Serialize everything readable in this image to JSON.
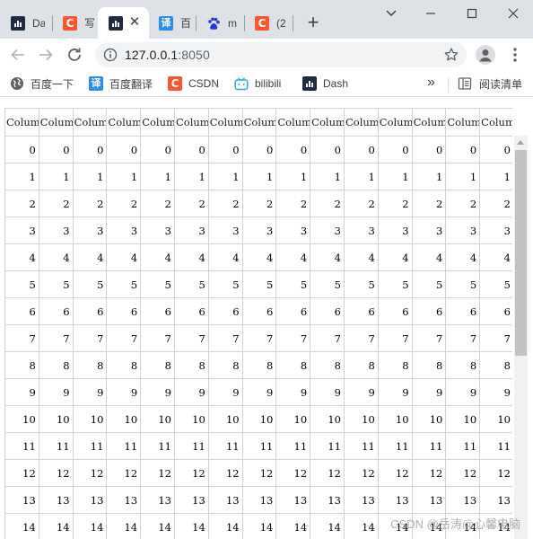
{
  "tabs": [
    {
      "icon": "dash-icon",
      "title": "Da"
    },
    {
      "icon": "csdn-icon",
      "title": "写"
    },
    {
      "icon": "dash-icon",
      "title": "",
      "active": true
    },
    {
      "icon": "translate-icon",
      "title": "百"
    },
    {
      "icon": "baidu-paw-icon",
      "title": "m"
    },
    {
      "icon": "csdn-icon",
      "title": "(2"
    }
  ],
  "address_bar": {
    "host": "127.0.0.1",
    "port": ":8050"
  },
  "bookmarks": [
    {
      "label": "百度一下",
      "icon": "globe-icon"
    },
    {
      "label": "百度翻译",
      "icon": "translate-icon"
    },
    {
      "label": "CSDN",
      "icon": "csdn-icon"
    },
    {
      "label": "bilibili",
      "icon": "bilibili-icon"
    },
    {
      "label": "Dash",
      "icon": "dash-icon"
    }
  ],
  "bookmarks_more": "»",
  "reading_list": {
    "label": "阅读清单",
    "icon": "reading-list-icon"
  },
  "csdn_glyph": "C",
  "translate_glyph": "译",
  "table": {
    "headers": [
      "Colum",
      "Colum",
      "Colum",
      "Colum",
      "Colum",
      "Colum",
      "Colum",
      "Colum",
      "Colum",
      "Colum",
      "Colum",
      "Colum",
      "Colum",
      "Colum",
      "Colum"
    ],
    "rows": [
      [
        "0",
        "0",
        "0",
        "0",
        "0",
        "0",
        "0",
        "0",
        "0",
        "0",
        "0",
        "0",
        "0",
        "0",
        "0"
      ],
      [
        "1",
        "1",
        "1",
        "1",
        "1",
        "1",
        "1",
        "1",
        "1",
        "1",
        "1",
        "1",
        "1",
        "1",
        "1"
      ],
      [
        "2",
        "2",
        "2",
        "2",
        "2",
        "2",
        "2",
        "2",
        "2",
        "2",
        "2",
        "2",
        "2",
        "2",
        "2"
      ],
      [
        "3",
        "3",
        "3",
        "3",
        "3",
        "3",
        "3",
        "3",
        "3",
        "3",
        "3",
        "3",
        "3",
        "3",
        "3"
      ],
      [
        "4",
        "4",
        "4",
        "4",
        "4",
        "4",
        "4",
        "4",
        "4",
        "4",
        "4",
        "4",
        "4",
        "4",
        "4"
      ],
      [
        "5",
        "5",
        "5",
        "5",
        "5",
        "5",
        "5",
        "5",
        "5",
        "5",
        "5",
        "5",
        "5",
        "5",
        "5"
      ],
      [
        "6",
        "6",
        "6",
        "6",
        "6",
        "6",
        "6",
        "6",
        "6",
        "6",
        "6",
        "6",
        "6",
        "6",
        "6"
      ],
      [
        "7",
        "7",
        "7",
        "7",
        "7",
        "7",
        "7",
        "7",
        "7",
        "7",
        "7",
        "7",
        "7",
        "7",
        "7"
      ],
      [
        "8",
        "8",
        "8",
        "8",
        "8",
        "8",
        "8",
        "8",
        "8",
        "8",
        "8",
        "8",
        "8",
        "8",
        "8"
      ],
      [
        "9",
        "9",
        "9",
        "9",
        "9",
        "9",
        "9",
        "9",
        "9",
        "9",
        "9",
        "9",
        "9",
        "9",
        "9"
      ],
      [
        "10",
        "10",
        "10",
        "10",
        "10",
        "10",
        "10",
        "10",
        "10",
        "10",
        "10",
        "10",
        "10",
        "10",
        "10"
      ],
      [
        "11",
        "11",
        "11",
        "11",
        "11",
        "11",
        "11",
        "11",
        "11",
        "11",
        "11",
        "11",
        "11",
        "11",
        "11"
      ],
      [
        "12",
        "12",
        "12",
        "12",
        "12",
        "12",
        "12",
        "12",
        "12",
        "12",
        "12",
        "12",
        "12",
        "12",
        "12"
      ],
      [
        "13",
        "13",
        "13",
        "13",
        "13",
        "13",
        "13",
        "13",
        "13",
        "13",
        "13",
        "13",
        "13",
        "13",
        "13"
      ],
      [
        "14",
        "14",
        "14",
        "14",
        "14",
        "14",
        "14",
        "14",
        "14",
        "14",
        "14",
        "14",
        "14",
        "14",
        "14"
      ]
    ]
  },
  "watermark": "CSDN @岳涛@心馨电脑",
  "colors": {
    "csdn": "#fc5531",
    "translate": "#2a8cf7",
    "dash": "#1f2a44",
    "bilibili": "#23ade5"
  }
}
